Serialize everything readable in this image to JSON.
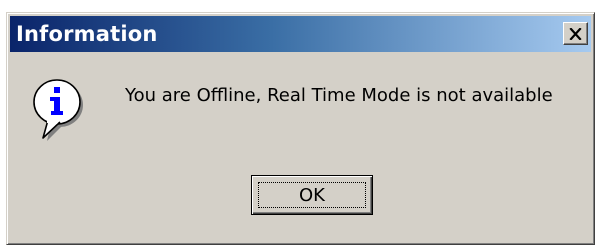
{
  "dialog": {
    "title": "Information",
    "message": "You are Offline, Real Time Mode is not available",
    "icon": "info-icon",
    "buttons": {
      "ok_label": "OK"
    },
    "close_icon": "close-icon"
  },
  "colors": {
    "titlebar_start": "#0a246a",
    "titlebar_end": "#a6caf0",
    "dialog_background": "#d4d0c8",
    "icon_letter": "#0000ff"
  }
}
